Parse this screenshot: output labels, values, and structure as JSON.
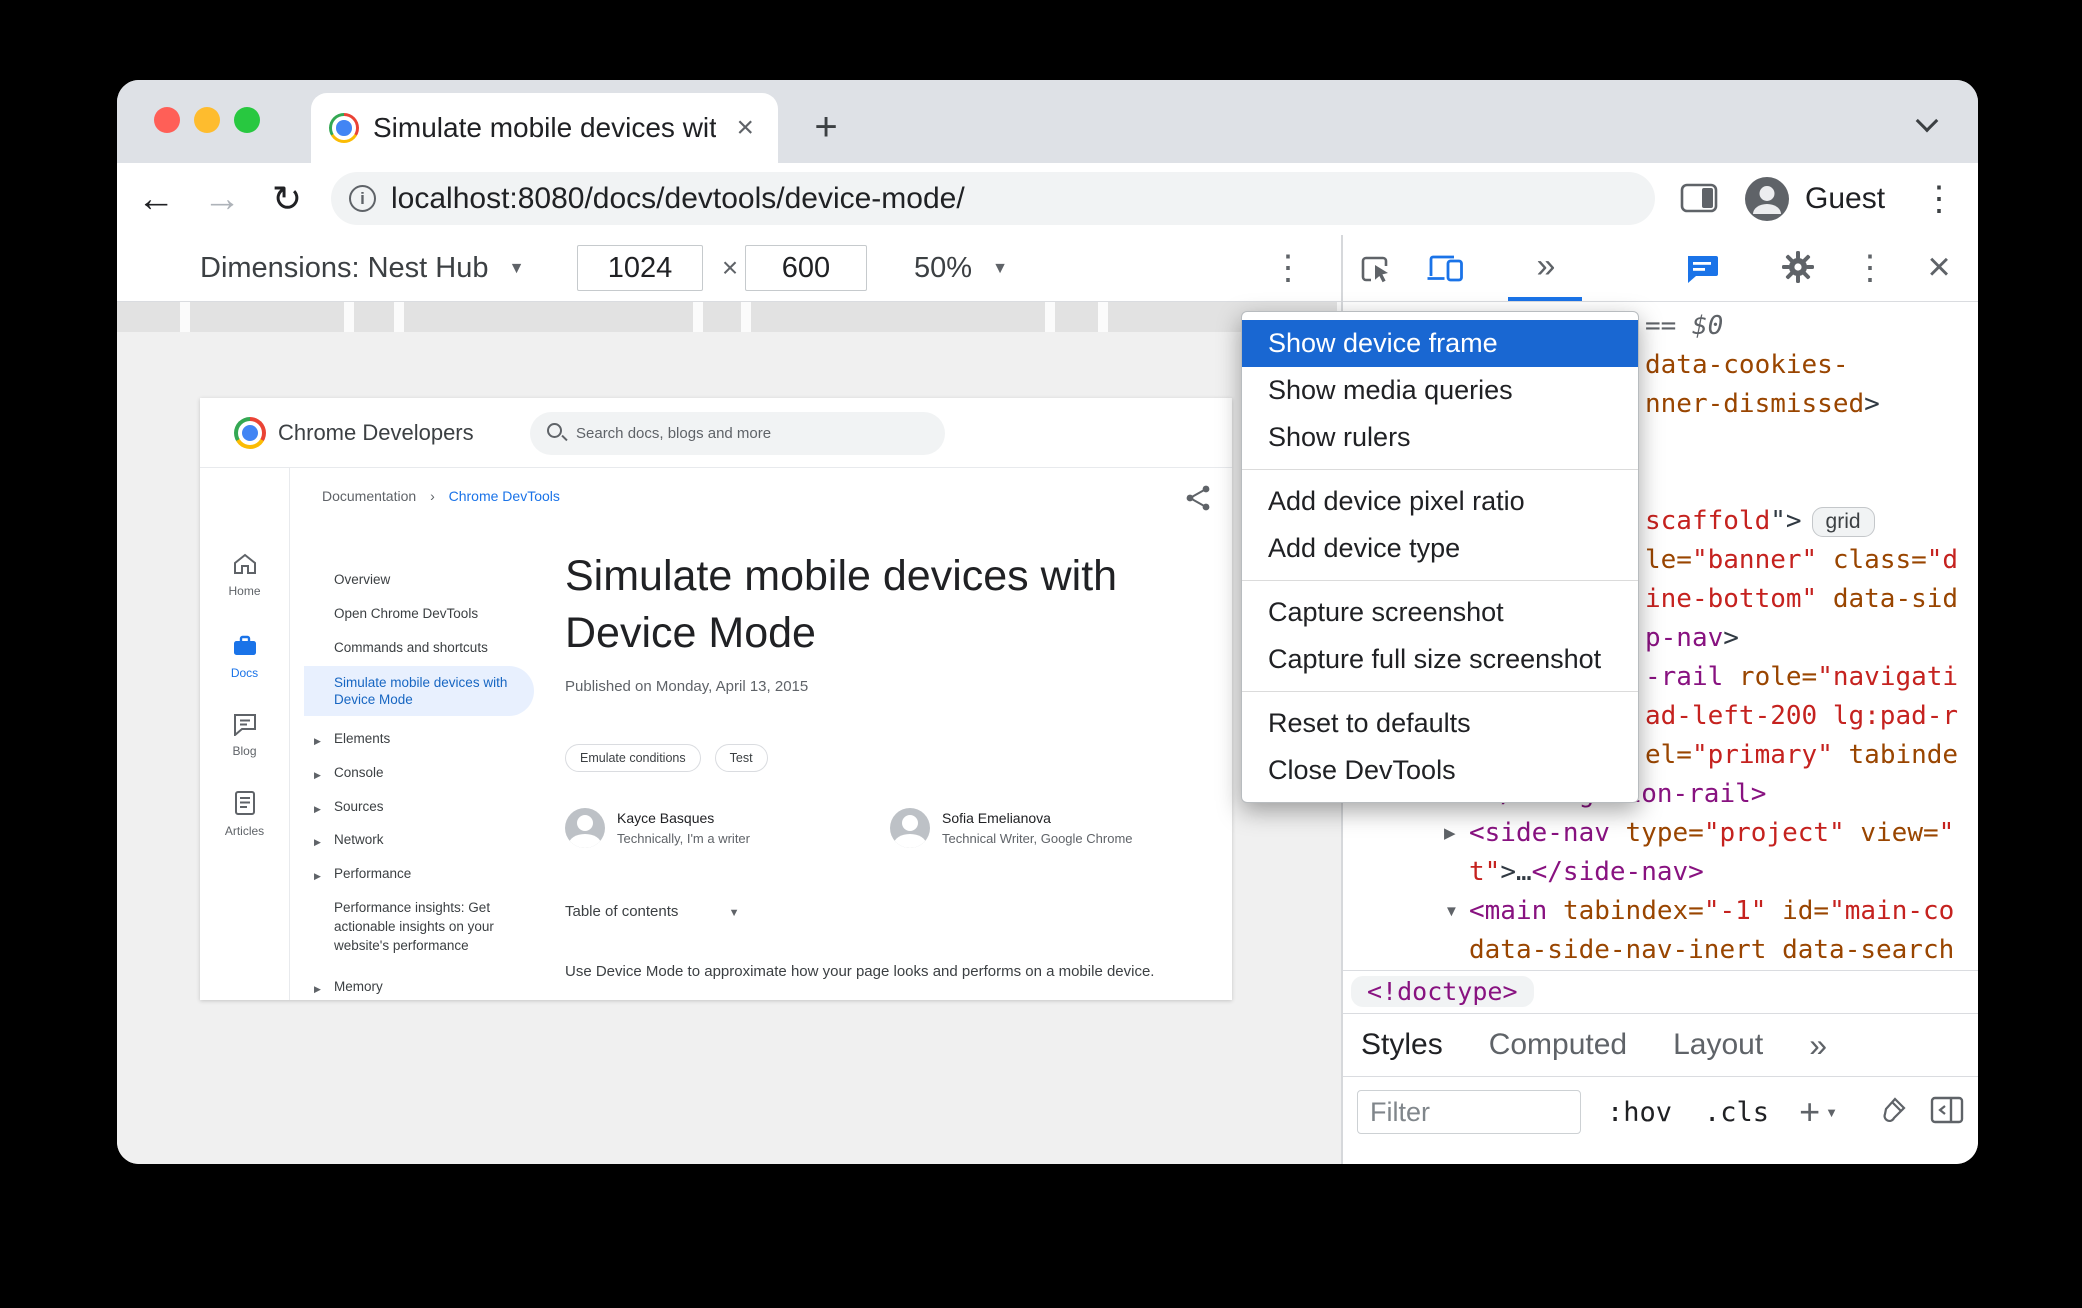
{
  "colors": {
    "accent": "#1a73e8",
    "menu_highlight": "#1967d2",
    "tag_color": "#881280",
    "attr_color": "#994500",
    "value_color": "#c5221f",
    "traffic_red": "#FF5F57",
    "traffic_yellow": "#FEBC2E",
    "traffic_green": "#28C840"
  },
  "browser": {
    "tab_title": "Simulate mobile devices with D",
    "url": "localhost:8080/docs/devtools/device-mode/",
    "guest_label": "Guest"
  },
  "device_toolbar": {
    "dimensions_label": "Dimensions: Nest Hub",
    "width_value": "1024",
    "times_separator": "×",
    "height_value": "600",
    "zoom_value": "50%"
  },
  "devtools_toolbar": {
    "more_tabs": "»"
  },
  "ruler_segments": [
    63,
    154,
    40,
    289,
    38,
    294,
    43,
    229
  ],
  "context_menu": {
    "selected": "Show device frame",
    "groups": [
      [
        "Show device frame",
        "Show media queries",
        "Show rulers"
      ],
      [
        "Add device pixel ratio",
        "Add device type"
      ],
      [
        "Capture screenshot",
        "Capture full size screenshot"
      ],
      [
        "Reset to defaults",
        "Close DevTools"
      ]
    ]
  },
  "site": {
    "brand": "Chrome Developers",
    "search_placeholder": "Search docs, blogs and more",
    "breadcrumbs": [
      "Documentation",
      "Chrome DevTools"
    ],
    "breadcrumb_sep": "›",
    "rail": [
      {
        "label": "Home",
        "icon": "home-icon",
        "active": false
      },
      {
        "label": "Docs",
        "icon": "docs-icon",
        "active": true
      },
      {
        "label": "Blog",
        "icon": "blog-icon",
        "active": false
      },
      {
        "label": "Articles",
        "icon": "articles-icon",
        "active": false
      }
    ],
    "nav": [
      {
        "label": "Overview"
      },
      {
        "label": "Open Chrome DevTools"
      },
      {
        "label": "Commands and shortcuts"
      },
      {
        "label": "Simulate mobile devices with Device Mode",
        "active": true
      },
      {
        "label": "Elements",
        "caret": true
      },
      {
        "label": "Console",
        "caret": true
      },
      {
        "label": "Sources",
        "caret": true
      },
      {
        "label": "Network",
        "caret": true
      },
      {
        "label": "Performance",
        "caret": true
      },
      {
        "label": "Performance insights: Get actionable insights on your website's performance",
        "multiline": true
      },
      {
        "label": "Memory",
        "caret": true
      }
    ],
    "article": {
      "title": "Simulate mobile devices with Device Mode",
      "published": "Published on Monday, April 13, 2015",
      "tags": [
        "Emulate conditions",
        "Test"
      ],
      "authors": [
        {
          "name": "Kayce Basques",
          "role": "Technically, I'm a writer"
        },
        {
          "name": "Sofia Emelianova",
          "role": "Technical Writer, Google Chrome"
        }
      ],
      "toc_label": "Table of contents",
      "intro": "Use Device Mode to approximate how your page looks and performs on a mobile device."
    }
  },
  "elements_panel": {
    "code_lines": [
      {
        "pad": 302,
        "tokens": [
          {
            "t": "== $0",
            "c": "marker"
          }
        ]
      },
      {
        "pad": 302,
        "tokens": [
          {
            "t": "data-cookies-",
            "c": "attr"
          }
        ]
      },
      {
        "pad": 302,
        "tokens": [
          {
            "t": "nner-dismissed",
            "c": "attr"
          },
          {
            "t": ">",
            "c": "plain"
          }
        ]
      },
      {
        "pad": 302,
        "tokens": []
      },
      {
        "pad": 302,
        "tokens": []
      },
      {
        "pad": 302,
        "tokens": [
          {
            "t": "scaffold",
            "c": "value"
          },
          {
            "t": "\">",
            "c": "plain"
          }
        ],
        "badge": "grid"
      },
      {
        "pad": 302,
        "tokens": [
          {
            "t": "le=",
            "c": "attr"
          },
          {
            "t": "\"banner\"",
            "c": "value"
          },
          {
            "t": " ",
            "c": "plain"
          },
          {
            "t": "class=",
            "c": "attr"
          },
          {
            "t": "\"d",
            "c": "value"
          }
        ]
      },
      {
        "pad": 302,
        "tokens": [
          {
            "t": "ine-bottom\"",
            "c": "value"
          },
          {
            "t": " ",
            "c": "plain"
          },
          {
            "t": "data-sid",
            "c": "attr"
          }
        ]
      },
      {
        "pad": 302,
        "tokens": [
          {
            "t": "p-nav",
            "c": "tag"
          },
          {
            "t": ">",
            "c": "plain"
          }
        ]
      },
      {
        "pad": 302,
        "tokens": [
          {
            "t": "-rail ",
            "c": "tag"
          },
          {
            "t": "role=",
            "c": "attr"
          },
          {
            "t": "\"navigati",
            "c": "value"
          }
        ]
      },
      {
        "pad": 302,
        "tokens": [
          {
            "t": "ad-left-200 lg:pad-r",
            "c": "value"
          }
        ]
      },
      {
        "pad": 302,
        "tokens": [
          {
            "t": "el=",
            "c": "attr"
          },
          {
            "t": "\"primary\"",
            "c": "value"
          },
          {
            "t": " ",
            "c": "plain"
          },
          {
            "t": "tabinde",
            "c": "attr"
          }
        ]
      },
      {
        "pad": 126,
        "tokens": [
          {
            "t": "…",
            "c": "plain"
          },
          {
            "t": "</navigation-rail>",
            "c": "tag"
          }
        ]
      },
      {
        "pad": 101,
        "twisty": "closed",
        "tokens": [
          {
            "t": "<side-nav",
            "c": "tag"
          },
          {
            "t": " ",
            "c": "plain"
          },
          {
            "t": "type=",
            "c": "attr"
          },
          {
            "t": "\"project\"",
            "c": "value"
          },
          {
            "t": " ",
            "c": "plain"
          },
          {
            "t": "view=",
            "c": "attr"
          },
          {
            "t": "\"",
            "c": "value"
          }
        ]
      },
      {
        "pad": 126,
        "tokens": [
          {
            "t": "t\"",
            "c": "value"
          },
          {
            "t": ">…",
            "c": "plain"
          },
          {
            "t": "</side-nav>",
            "c": "tag"
          }
        ]
      },
      {
        "pad": 101,
        "twisty": "open",
        "tokens": [
          {
            "t": "<main",
            "c": "tag"
          },
          {
            "t": " ",
            "c": "plain"
          },
          {
            "t": "tabindex=",
            "c": "attr"
          },
          {
            "t": "\"-1\"",
            "c": "value"
          },
          {
            "t": " ",
            "c": "plain"
          },
          {
            "t": "id=",
            "c": "attr"
          },
          {
            "t": "\"main-co",
            "c": "value"
          }
        ]
      },
      {
        "pad": 126,
        "tokens": [
          {
            "t": "data-side-nav-inert",
            "c": "attr"
          },
          {
            "t": " ",
            "c": "plain"
          },
          {
            "t": "data-search",
            "c": "attr"
          }
        ]
      }
    ],
    "doctype_crumb": "<!doctype>",
    "tabs": [
      "Styles",
      "Computed",
      "Layout"
    ],
    "tabs_more": "»",
    "filter_placeholder": "Filter",
    "pseudo_toggle": ":hov",
    "class_toggle": ".cls",
    "new_rule": "+"
  }
}
